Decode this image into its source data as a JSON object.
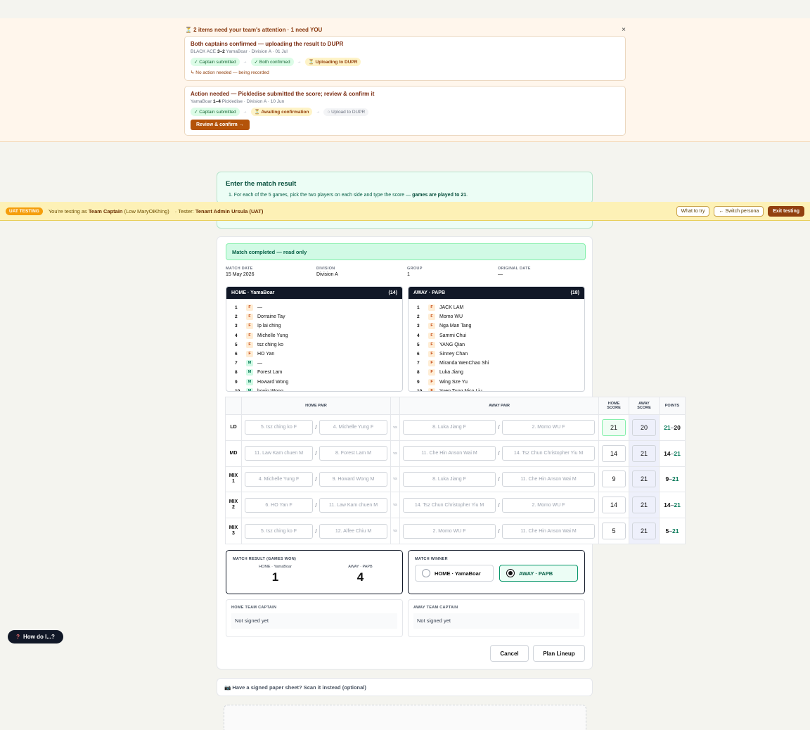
{
  "attention": {
    "header": "⏳ 2 items need your team's attention · 1 need YOU",
    "close": "×",
    "cards": [
      {
        "title": "Both captains confirmed — uploading the result to DUPR",
        "sub_a": "BLACK ACE ",
        "sub_score": "3–2",
        "sub_b": " YamaBoar · Division A · 01 Jul",
        "chips": [
          "✓ Captain submitted",
          "→",
          "✓ Both confirmed",
          "→",
          "⏳ Uploading to DUPR"
        ],
        "note": "↳ No action needed — being recorded"
      },
      {
        "title": "Action needed — Pickledise submitted the score; review & confirm it",
        "sub_a": "YamaBoar ",
        "sub_score": "1–4",
        "sub_b": " Pickledise · Division A · 10 Jun",
        "chips": [
          "✓ Captain submitted",
          "→",
          "⏳ Awaiting confirmation",
          "→",
          "○ Upload to DUPR"
        ],
        "button": "Review & confirm →"
      }
    ]
  },
  "instructions": {
    "title": "Enter the match result",
    "line_a": "1. For each of the 5 games, pick the two players on each side and type the score — ",
    "line_b": "games are played to 21",
    "line_c": "."
  },
  "uat": {
    "tag": "UAT TESTING",
    "t1": "You're testing as ",
    "role": "Team Captain",
    "t2": " (Low MaryOiKhing)",
    "t3": " · Tester: ",
    "tester": "Tenant Admin Ursula (UAT)",
    "btn_try": "What to try",
    "btn_switch": "← Switch persona",
    "btn_exit": "Exit testing"
  },
  "status": "Match completed — read only",
  "meta": [
    {
      "k": "MATCH DATE",
      "v": "15 May 2026"
    },
    {
      "k": "DIVISION",
      "v": "Division A"
    },
    {
      "k": "GROUP",
      "v": "1"
    },
    {
      "k": "ORIGINAL DATE",
      "v": "—"
    }
  ],
  "home": {
    "header": "HOME · YamaBoar",
    "count": "(14)",
    "players": [
      {
        "n": "1",
        "g": "F",
        "name": "—"
      },
      {
        "n": "2",
        "g": "F",
        "name": "Dorraine Tay"
      },
      {
        "n": "3",
        "g": "F",
        "name": "Ip lai ching"
      },
      {
        "n": "4",
        "g": "F",
        "name": "Michelle Yung"
      },
      {
        "n": "5",
        "g": "F",
        "name": "tsz ching ko"
      },
      {
        "n": "6",
        "g": "F",
        "name": "HO Yan"
      },
      {
        "n": "7",
        "g": "M",
        "name": "—"
      },
      {
        "n": "8",
        "g": "M",
        "name": "Forest Lam"
      },
      {
        "n": "9",
        "g": "M",
        "name": "Howard Wong"
      },
      {
        "n": "10",
        "g": "M",
        "name": "hovin Wong"
      }
    ]
  },
  "away": {
    "header": "AWAY · PAPB",
    "count": "(18)",
    "players": [
      {
        "n": "1",
        "g": "F",
        "name": "JACK LAM"
      },
      {
        "n": "2",
        "g": "F",
        "name": "Momo WU"
      },
      {
        "n": "3",
        "g": "F",
        "name": "Nga Man Tang"
      },
      {
        "n": "4",
        "g": "F",
        "name": "Sammi Chui"
      },
      {
        "n": "5",
        "g": "F",
        "name": "YANG Qian"
      },
      {
        "n": "6",
        "g": "F",
        "name": "Sinney Chan"
      },
      {
        "n": "7",
        "g": "F",
        "name": "Miranda WenChao Shi"
      },
      {
        "n": "8",
        "g": "F",
        "name": "Luka Jiang"
      },
      {
        "n": "9",
        "g": "F",
        "name": "Wing Sze Yu"
      },
      {
        "n": "10",
        "g": "F",
        "name": "Yuen Tung Nico Liu"
      }
    ]
  },
  "games_headers": {
    "home_pair": "HOME PAIR",
    "away_pair": "AWAY PAIR",
    "home_score_1": "HOME",
    "home_score_2": "SCORE",
    "away_score_1": "AWAY",
    "away_score_2": "SCORE",
    "points": "POINTS"
  },
  "games": [
    {
      "l1": "LD",
      "l2": "",
      "h1": "5. tsz ching ko F",
      "h2": "4. Michelle Yung F",
      "a1": "8. Luka Jiang F",
      "a2": "2. Momo WU F",
      "hs": "21",
      "as": "20",
      "p_home": "21",
      "p_away": "20",
      "winner": "home"
    },
    {
      "l1": "MD",
      "l2": "",
      "h1": "11. Law Kam chuen M",
      "h2": "8. Forest Lam M",
      "a1": "11. Che Hin Anson Wai M",
      "a2": "14. Tsz Chun Christopher Yiu M",
      "hs": "14",
      "as": "21",
      "p_home": "14",
      "p_away": "21",
      "winner": "away"
    },
    {
      "l1": "MIX",
      "l2": "1",
      "h1": "4. Michelle Yung F",
      "h2": "9. Howard Wong M",
      "a1": "8. Luka Jiang F",
      "a2": "11. Che Hin Anson Wai M",
      "hs": "9",
      "as": "21",
      "p_home": "9",
      "p_away": "21",
      "winner": "away"
    },
    {
      "l1": "MIX",
      "l2": "2",
      "h1": "6. HO Yan F",
      "h2": "11. Law Kam chuen M",
      "a1": "14. Tsz Chun Christopher Yiu M",
      "a2": "2. Momo WU F",
      "hs": "14",
      "as": "21",
      "p_home": "14",
      "p_away": "21",
      "winner": "away"
    },
    {
      "l1": "MIX",
      "l2": "3",
      "h1": "5. tsz ching ko F",
      "h2": "12. Alfee Chiu M",
      "a1": "2. Momo WU F",
      "a2": "11. Che Hin Anson Wai M",
      "hs": "5",
      "as": "21",
      "p_home": "5",
      "p_away": "21",
      "winner": "away"
    }
  ],
  "pts_sep": "–",
  "vs": "vs",
  "slash": "/",
  "result": {
    "label": "MATCH RESULT (GAMES WON)",
    "home_label": "HOME · YamaBoar",
    "away_label": "AWAY · PAPB",
    "home_won": "1",
    "away_won": "4"
  },
  "winner": {
    "label": "MATCH WINNER",
    "home": "HOME · YamaBoar",
    "away": "AWAY · PAPB",
    "selected": "away"
  },
  "captains": {
    "home_label": "HOME TEAM CAPTAIN",
    "home_value": "Not signed yet",
    "away_label": "AWAY TEAM CAPTAIN",
    "away_value": "Not signed yet"
  },
  "actions": {
    "cancel": "Cancel",
    "plan": "Plan Lineup"
  },
  "scan": "📷 Have a signed paper sheet? Scan it instead (optional)",
  "help": {
    "q": "?",
    "label": "How do I...?"
  }
}
